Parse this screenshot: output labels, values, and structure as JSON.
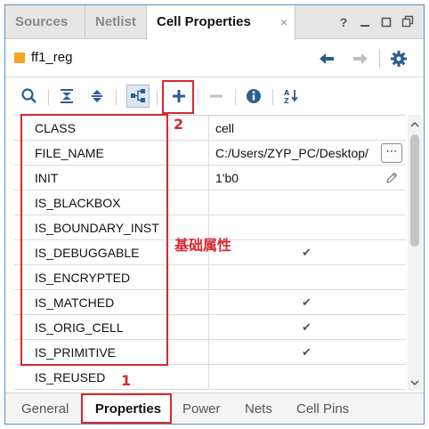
{
  "tabs": [
    {
      "label": "Sources",
      "active": false
    },
    {
      "label": "Netlist",
      "active": false
    },
    {
      "label": "Cell Properties",
      "active": true
    }
  ],
  "tab_close_glyph": "×",
  "window_controls": {
    "help": "?"
  },
  "header": {
    "cell_name": "ff1_reg",
    "cell_icon_color": "#f5a623"
  },
  "properties": [
    {
      "name": "CLASS",
      "value": "cell"
    },
    {
      "name": "FILE_NAME",
      "value": "C:/Users/ZYP_PC/Desktop/",
      "browse": "⋯"
    },
    {
      "name": "INIT",
      "value": "1'b0",
      "editable": true
    },
    {
      "name": "IS_BLACKBOX",
      "value": ""
    },
    {
      "name": "IS_BOUNDARY_INST",
      "value": ""
    },
    {
      "name": "IS_DEBUGGABLE",
      "checked": true
    },
    {
      "name": "IS_ENCRYPTED",
      "value": ""
    },
    {
      "name": "IS_MATCHED",
      "checked": true
    },
    {
      "name": "IS_ORIG_CELL",
      "checked": true
    },
    {
      "name": "IS_PRIMITIVE",
      "checked": true
    },
    {
      "name": "IS_REUSED",
      "value": ""
    }
  ],
  "check_glyph": "✔",
  "bottom_tabs": [
    {
      "label": "General",
      "active": false
    },
    {
      "label": "Properties",
      "active": true
    },
    {
      "label": "Power",
      "active": false
    },
    {
      "label": "Nets",
      "active": false
    },
    {
      "label": "Cell Pins",
      "active": false
    }
  ],
  "annotations": {
    "marker_1": "1",
    "marker_2": "2",
    "basic_props": "基础属性",
    "color": "#d7282f"
  },
  "colors": {
    "accent": "#2c5d8f",
    "window_border": "#5b8fc4"
  }
}
